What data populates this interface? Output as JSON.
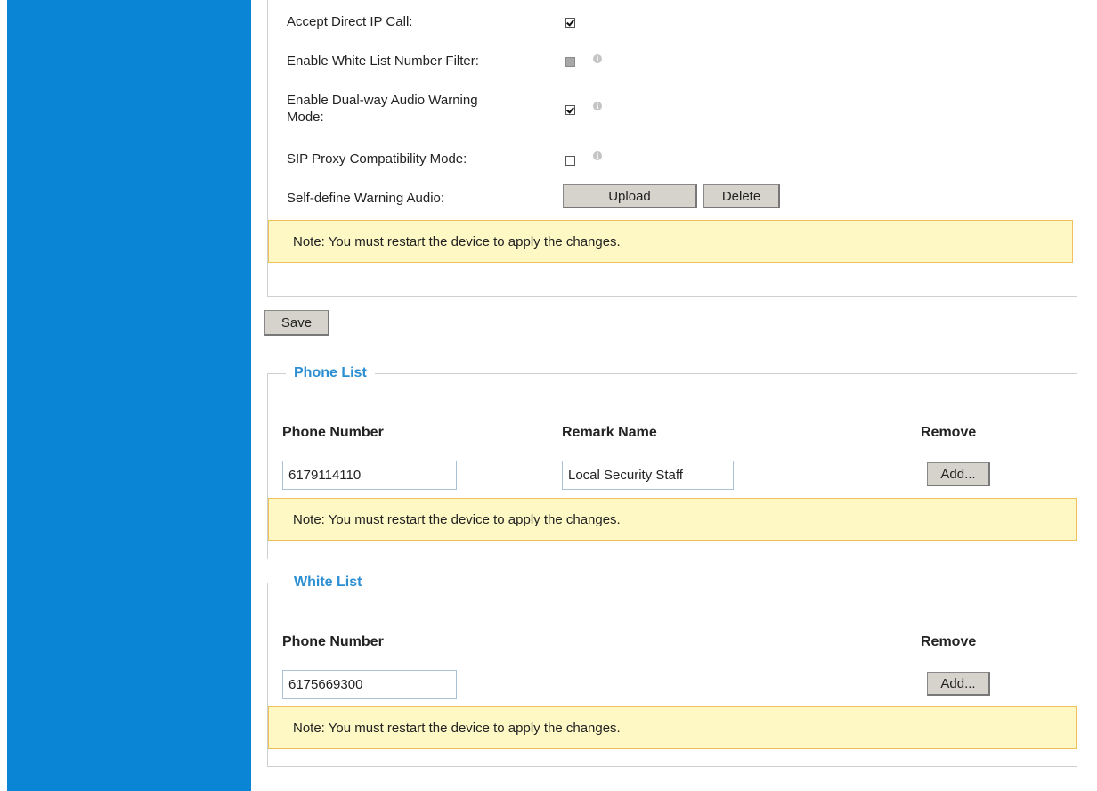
{
  "settings": {
    "accept_direct_ip_call": {
      "label": "Accept Direct IP Call:",
      "checked": true
    },
    "white_list_filter": {
      "label": "Enable White List Number Filter:",
      "checked": false,
      "disabled": true
    },
    "dual_way_audio": {
      "label_line1": "Enable Dual-way Audio Warning",
      "label_line2": "Mode:",
      "checked": true
    },
    "sip_proxy_compat": {
      "label": "SIP Proxy Compatibility Mode:",
      "checked": false
    },
    "warning_audio": {
      "label": "Self-define Warning Audio:",
      "upload_label": "Upload",
      "delete_label": "Delete"
    },
    "note": "Note: You must restart the device to apply the changes."
  },
  "save_label": "Save",
  "phone_list": {
    "title": "Phone List",
    "col_phone": "Phone Number",
    "col_remark": "Remark Name",
    "col_remove": "Remove",
    "phone_value": "6179114110",
    "remark_value": "Local Security Staff",
    "add_label": "Add...",
    "note": "Note: You must restart the device to apply the changes."
  },
  "white_list": {
    "title": "White List",
    "col_phone": "Phone Number",
    "col_remove": "Remove",
    "phone_value": "6175669300",
    "add_label": "Add...",
    "note": "Note: You must restart the device to apply the changes."
  },
  "colors": {
    "sidebar": "#0a84d4",
    "legend": "#2b8fd2",
    "note_bg": "#fdf8c4",
    "note_border": "#f0c05a"
  },
  "icons": [
    "info-icon",
    "checkbox-icon"
  ]
}
